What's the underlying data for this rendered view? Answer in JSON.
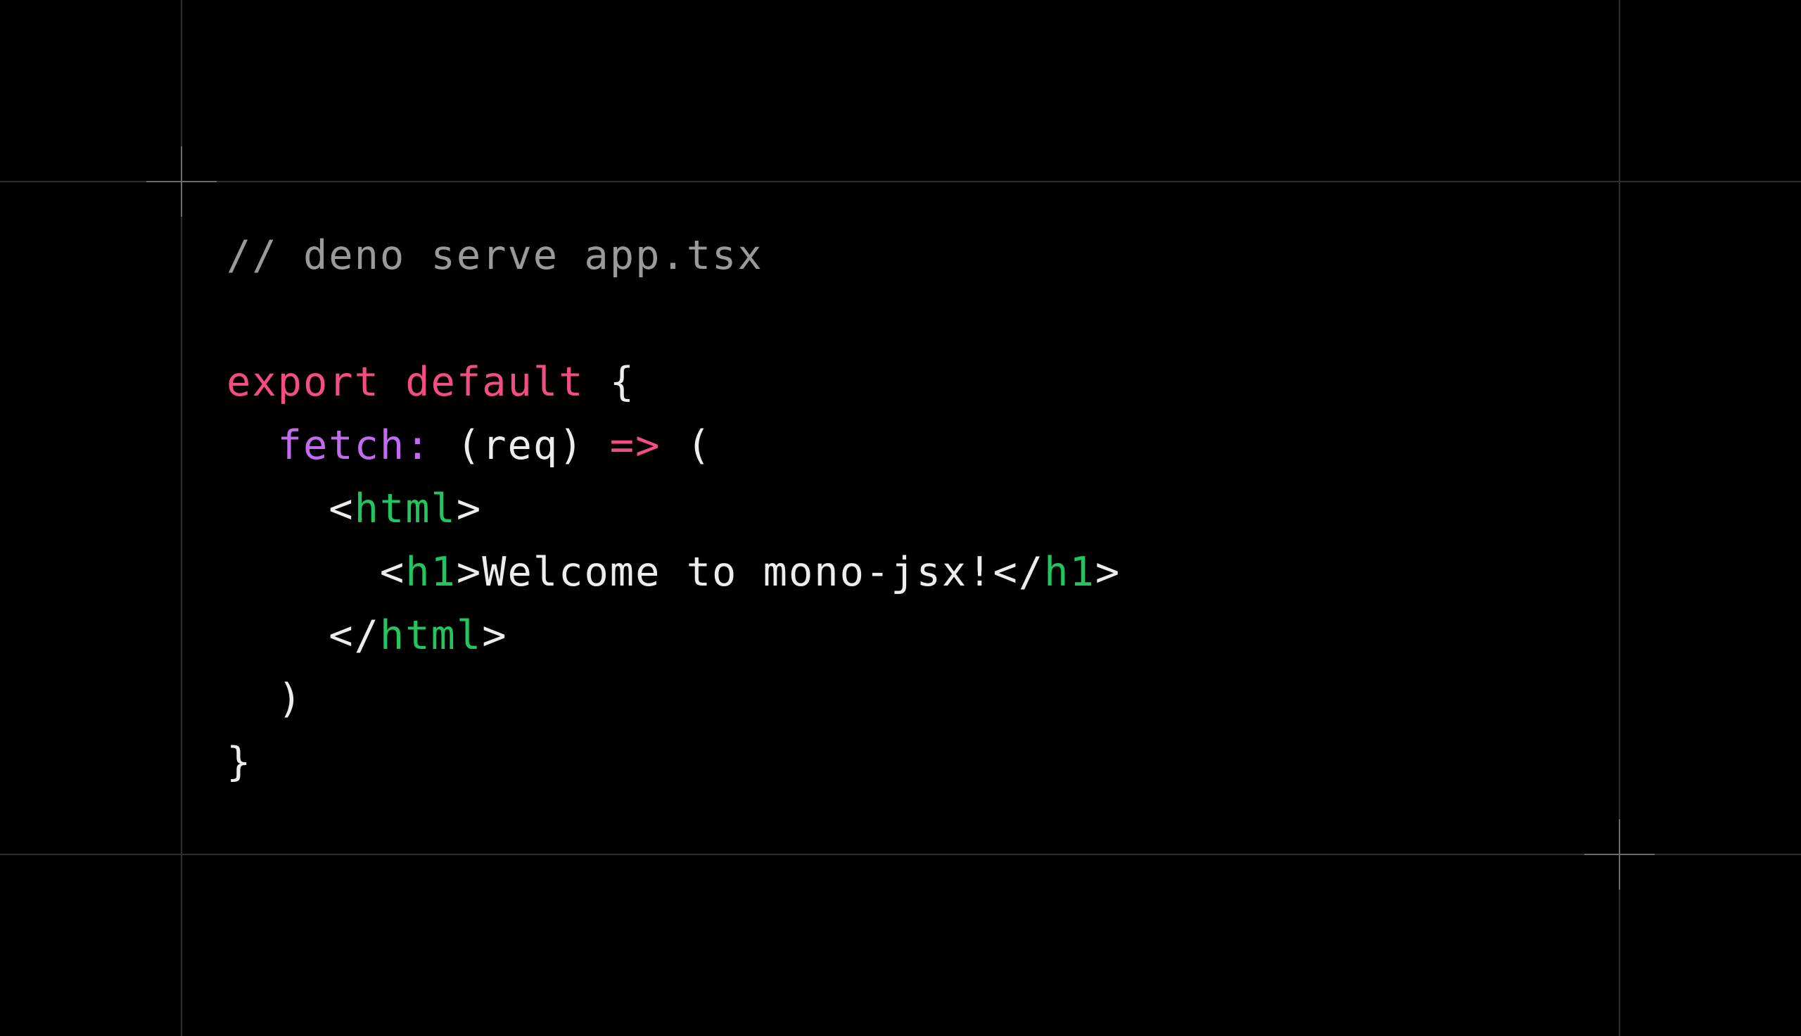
{
  "code": {
    "comment": "// deno serve app.tsx",
    "export_kw": "export",
    "default_kw": "default",
    "open_brace": "{",
    "fetch_prop": "fetch:",
    "args": "(req)",
    "arrow": "=>",
    "open_paren": "(",
    "html_open_lt": "<",
    "html_tag": "html",
    "html_open_gt": ">",
    "h1_open_lt": "<",
    "h1_tag": "h1",
    "h1_text": ">Welcome to mono-jsx!</",
    "h1_close_tag": "h1",
    "h1_close_gt": ">",
    "html_close_lt": "</",
    "html_close_tag": "html",
    "html_close_gt": ">",
    "close_paren": ")",
    "close_brace": "}"
  },
  "colors": {
    "background": "#000000",
    "comment": "#9a9a9a",
    "keyword": "#f24d86",
    "property": "#c26bf0",
    "tag": "#22c55e",
    "text": "#ededed"
  }
}
